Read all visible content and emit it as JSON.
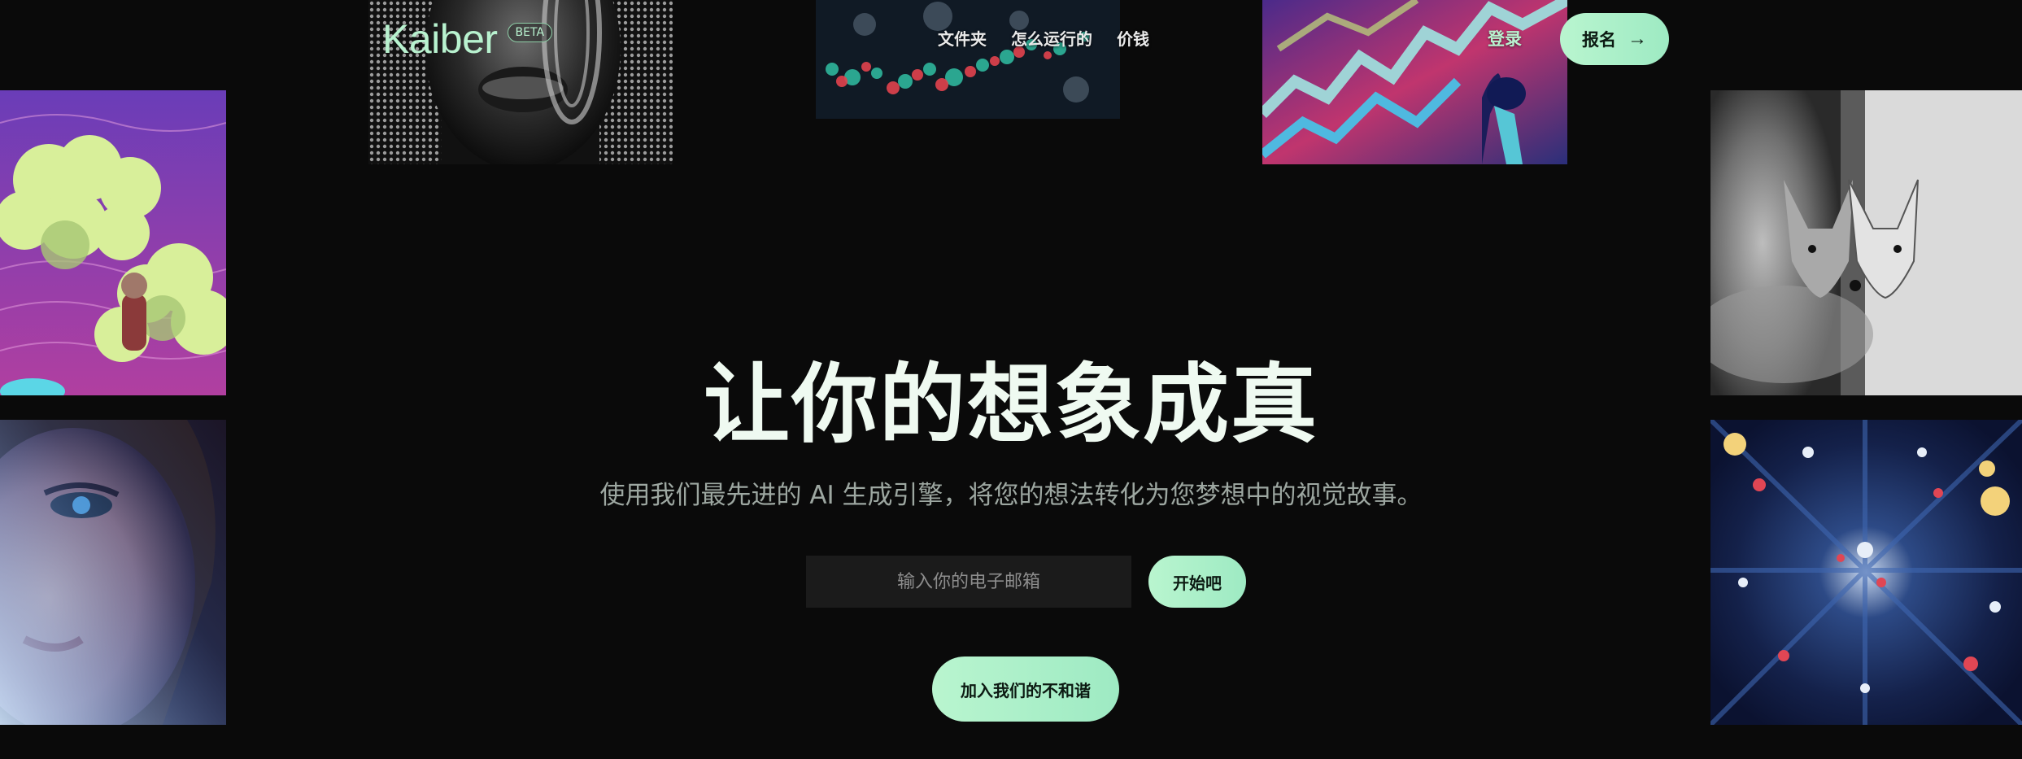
{
  "header": {
    "logo": "Kaiber",
    "badge": "BETA",
    "nav": [
      "文件夹",
      "怎么运行的",
      "价钱"
    ],
    "login": "登录",
    "signup": "报名",
    "signup_icon": "arrow-right-icon"
  },
  "hero": {
    "title": "让你的想象成真",
    "subtitle": "使用我们最先进的 AI 生成引擎，将您的想法转化为您梦想中的视觉故事。",
    "email_placeholder": "输入你的电子邮箱",
    "start_button": "开始吧",
    "discord_button": "加入我们的不和谐"
  },
  "theme": {
    "background": "#0a0a0a",
    "accent": "#b9f5cf",
    "title_color": "#effaf1",
    "subtitle_color": "#9da7a1"
  }
}
